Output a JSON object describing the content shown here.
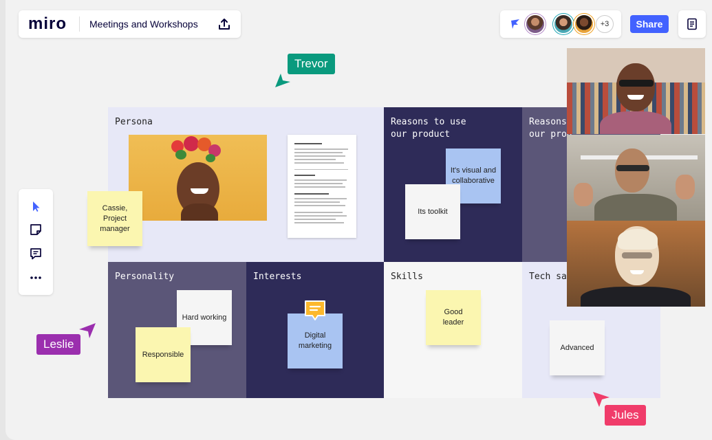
{
  "app": {
    "logo": "miro",
    "board_title": "Meetings and Workshops"
  },
  "header": {
    "share_label": "Share",
    "extra_collaborators": "+3"
  },
  "colors": {
    "accent": "#4262ff",
    "lavender": "#e7e8f7",
    "navy": "#2e2b58",
    "slate": "#5b5678",
    "sticky_yellow": "#fbf6b0",
    "sticky_blue": "#a9c4f2",
    "sticky_white": "#f5f5f5"
  },
  "board": {
    "cells": [
      {
        "label": "Persona"
      },
      {
        "label": "Reasons to use\nour product"
      },
      {
        "label": "Reasons\nour prod"
      },
      {
        "label": "Personality"
      },
      {
        "label": "Interests"
      },
      {
        "label": "Skills"
      },
      {
        "label": "Tech sav"
      }
    ],
    "stickies": {
      "persona": "Cassie,\nProject\nmanager",
      "visual": "It's visual and\ncollaborative",
      "toolkit": "Its toolkit",
      "hard_working": "Hard working",
      "responsible": "Responsible",
      "digital_marketing": "Digital\nmarketing",
      "good_leader": "Good\nleader",
      "advanced": "Advanced"
    }
  },
  "cursors": {
    "trevor": {
      "name": "Trevor",
      "color": "#0a9a7e"
    },
    "leslie": {
      "name": "Leslie",
      "color": "#9b2fae"
    },
    "jules": {
      "name": "Jules",
      "color": "#f03c6a"
    }
  },
  "toolbar": {
    "tools": [
      "select-icon",
      "sticky-note-icon",
      "comment-icon",
      "more-icon"
    ]
  }
}
